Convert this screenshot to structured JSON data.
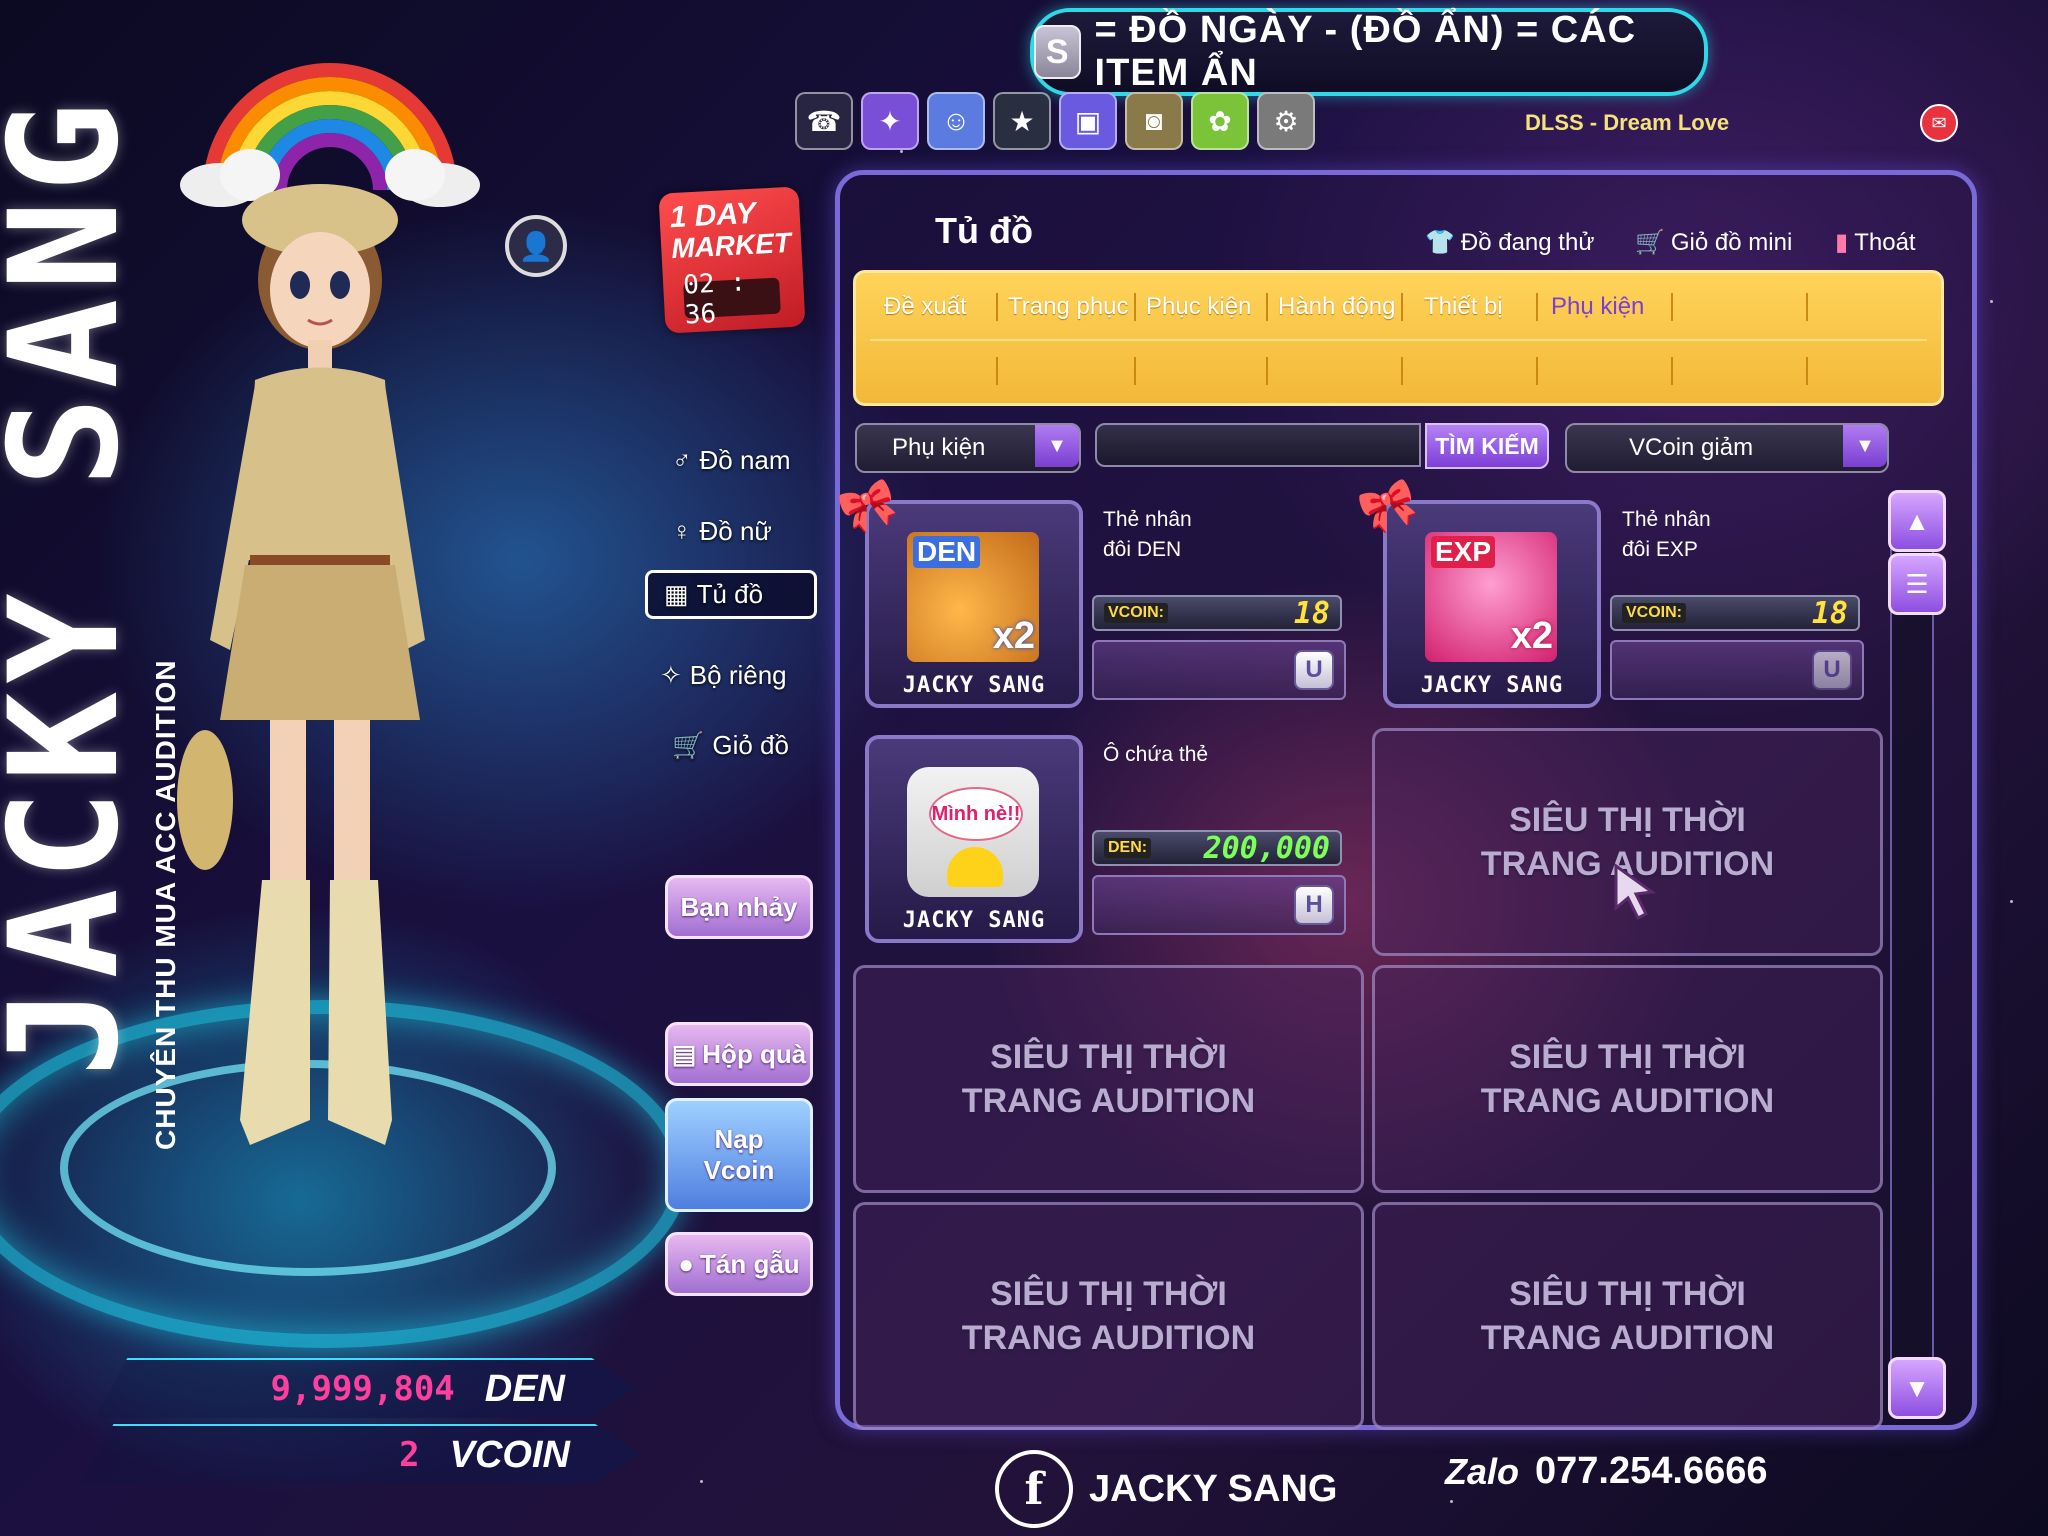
{
  "brand": {
    "vertical_name": "JACKY SANG",
    "subtitle": "CHUYÊN THU MUA ACC AUDITION"
  },
  "top_banner": {
    "badge": "S",
    "text": "= ĐỒ NGÀY - (ĐỒ ẨN) = CÁC ITEM ẨN"
  },
  "top_icons": [
    {
      "name": "phone-icon",
      "glyph": "☎"
    },
    {
      "name": "ghost-icon",
      "glyph": "☺"
    },
    {
      "name": "star-icon",
      "glyph": "★"
    },
    {
      "name": "gift-icon",
      "glyph": "🎁"
    },
    {
      "name": "photo-icon",
      "glyph": "📷"
    },
    {
      "name": "garden-icon",
      "glyph": "✿"
    },
    {
      "name": "settings-icon",
      "glyph": "⚙"
    }
  ],
  "server_label": "DLSS - Dream Love",
  "market": {
    "line1": "1 DAY",
    "line2": "MARKET",
    "timer": "02 : 36"
  },
  "left_menu": {
    "do_nam": "Đồ nam",
    "do_nu": "Đồ nữ",
    "tu_do": "Tủ đồ",
    "bo_rieng": "Bộ riêng",
    "gio_do": "Giỏ đồ",
    "ban_nhay": "Bạn nhảy",
    "hop_qua": "Hộp quà",
    "nap_vcoin": "Nạp Vcoin",
    "tan_gau": "Tán gẫu"
  },
  "currency": {
    "den_value": "9,999,804",
    "den_unit": "DEN",
    "vcoin_value": "2",
    "vcoin_unit": "VCOIN"
  },
  "panel": {
    "title": "Tủ đồ",
    "actions": {
      "try_on": "Đồ đang thử",
      "mini_cart": "Giỏ đồ mini",
      "exit": "Thoát"
    },
    "tabs": [
      "Đề xuất",
      "Trang phục",
      "Phục kiện",
      "Hành động",
      "Thiết bị",
      "Phụ kiện"
    ],
    "active_tab": "Phụ kiện",
    "filter_category": "Phụ kiện",
    "search_label": "TÌM KIẾM",
    "search_value": "",
    "sort": "VCoin giảm"
  },
  "items": [
    {
      "name_line1": "Thẻ nhân",
      "name_line2": "đôi DEN",
      "art_text": "DEN x2",
      "owner": "JACKY SANG",
      "currency": "VCOIN:",
      "price": "18",
      "flag": "U"
    },
    {
      "name_line1": "Thẻ nhân",
      "name_line2": "đôi EXP",
      "art_text": "EXP x2",
      "owner": "JACKY SANG",
      "currency": "VCOIN:",
      "price": "18",
      "flag": "U"
    },
    {
      "name_line1": "Ô chứa thẻ",
      "name_line2": "",
      "art_text": "Mình nè!!",
      "owner": "JACKY SANG",
      "currency": "DEN:",
      "price": "200,000",
      "flag": "H"
    }
  ],
  "placeholder_text": {
    "line1": "SIÊU THỊ THỜI",
    "line2": "TRANG AUDITION"
  },
  "footer": {
    "facebook_name": "JACKY SANG",
    "zalo_label": "Zalo",
    "phone": "077.254.6666"
  },
  "colors": {
    "accent": "#7b3fd6",
    "tab_bar": "#f2b838",
    "cyan_glow": "#2fd8e6",
    "den_pink": "#ff3f9e"
  }
}
